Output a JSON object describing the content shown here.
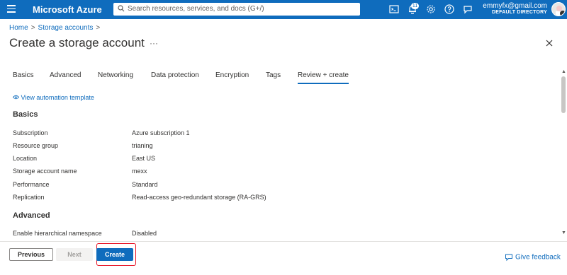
{
  "topbar": {
    "brand": "Microsoft Azure",
    "search_placeholder": "Search resources, services, and docs (G+/)",
    "notification_count": "11",
    "user_email": "emmyfx@gmail.com",
    "user_directory": "DEFAULT DIRECTORY"
  },
  "breadcrumb": {
    "home": "Home",
    "current": "Storage accounts"
  },
  "page": {
    "title": "Create a storage account",
    "more": "···"
  },
  "tabs": [
    "Basics",
    "Advanced",
    "Networking",
    "Data protection",
    "Encryption",
    "Tags",
    "Review + create"
  ],
  "automation_link": "View automation template",
  "sections": {
    "basics": {
      "heading": "Basics",
      "rows": [
        {
          "label": "Subscription",
          "value": "Azure subscription 1"
        },
        {
          "label": "Resource group",
          "value": "trianing"
        },
        {
          "label": "Location",
          "value": "East US"
        },
        {
          "label": "Storage account name",
          "value": "mexx"
        },
        {
          "label": "Performance",
          "value": "Standard"
        },
        {
          "label": "Replication",
          "value": "Read-access geo-redundant storage (RA-GRS)"
        }
      ]
    },
    "advanced": {
      "heading": "Advanced",
      "rows": [
        {
          "label": "Enable hierarchical namespace",
          "value": "Disabled"
        }
      ]
    }
  },
  "footer": {
    "previous": "Previous",
    "next": "Next",
    "create": "Create",
    "feedback": "Give feedback"
  },
  "colors": {
    "accent": "#0f6cbd",
    "highlight": "#e81123"
  }
}
